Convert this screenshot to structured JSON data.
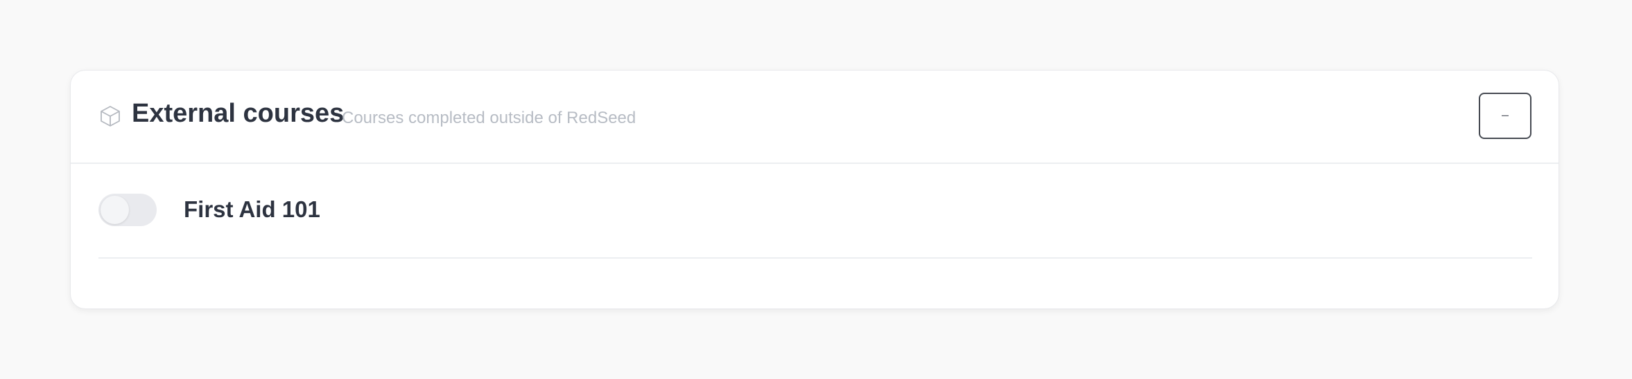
{
  "card": {
    "icon": "cube-icon",
    "title": "External courses",
    "subtitle": "Courses completed outside of RedSeed",
    "collapse_label": "–"
  },
  "courses": [
    {
      "label": "First Aid 101",
      "enabled": false
    }
  ],
  "colors": {
    "background": "#f9f9f9",
    "card": "#ffffff",
    "title_text": "#2d3340",
    "subtitle_text": "#b7bcc4",
    "toggle_off": "#e9eaee"
  }
}
